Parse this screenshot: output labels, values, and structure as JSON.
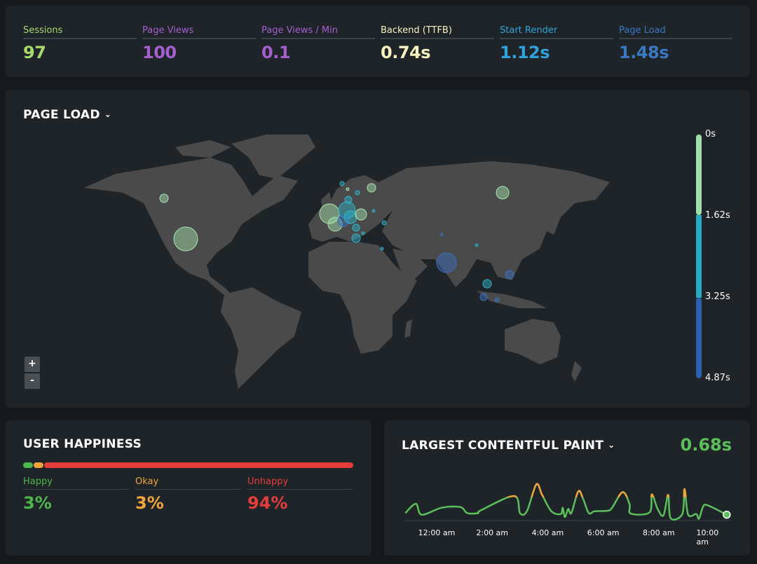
{
  "stats": [
    {
      "label": "Sessions",
      "value": "97",
      "color": "#a6d96a"
    },
    {
      "label": "Page Views",
      "value": "100",
      "color": "#a45fd0"
    },
    {
      "label": "Page Views / Min",
      "value": "0.1",
      "color": "#a45fd0"
    },
    {
      "label": "Backend (TTFB)",
      "value": "0.74s",
      "color": "#f7f3c0"
    },
    {
      "label": "Start Render",
      "value": "1.12s",
      "color": "#2ea3dc"
    },
    {
      "label": "Page Load",
      "value": "1.48s",
      "color": "#3a78c4"
    }
  ],
  "map": {
    "title": "PAGE LOAD",
    "legend": [
      "0s",
      "1.62s",
      "3.25s",
      "4.87s"
    ],
    "legend_colors": [
      "#9ddfa8",
      "#28a9c4",
      "#2b5fb0"
    ],
    "zoom_in": "+",
    "zoom_out": "-"
  },
  "happiness": {
    "title": "USER HAPPINESS",
    "segments": [
      {
        "label": "Happy",
        "value": "3%",
        "pct": 3,
        "color": "#4cb84c"
      },
      {
        "label": "Okay",
        "value": "3%",
        "pct": 3,
        "color": "#f2a33a"
      },
      {
        "label": "Unhappy",
        "value": "94%",
        "pct": 94,
        "color": "#e53c3c"
      }
    ]
  },
  "lcp": {
    "title": "LARGEST CONTENTFUL PAINT",
    "value": "0.68s",
    "color": "#5bbf5b",
    "warn_color": "#f2a33a",
    "ticks": [
      "12:00 am",
      "2:00 am",
      "4:00 am",
      "6:00 am",
      "8:00 am",
      "10:00 am"
    ]
  },
  "chart_data": {
    "type": "line",
    "xlabel": "",
    "ylabel": "",
    "x_ticks": [
      "12:00 am",
      "2:00 am",
      "4:00 am",
      "6:00 am",
      "8:00 am",
      "10:00 am"
    ],
    "x_hours": [
      -1.13,
      -0.75,
      -0.54,
      0.18,
      0.85,
      1.1,
      1.48,
      1.61,
      2.79,
      3.0,
      3.25,
      3.59,
      3.8,
      4.13,
      4.47,
      4.54,
      4.62,
      4.74,
      4.85,
      5.1,
      5.27,
      5.48,
      5.69,
      6.15,
      6.32,
      6.7,
      6.95,
      6.99,
      7.67,
      7.75,
      7.96,
      8.17,
      8.34,
      8.43,
      8.85,
      8.93,
      9.06,
      9.35,
      9.45,
      9.6,
      9.77,
      10.45
    ],
    "values": [
      0.32,
      0.72,
      0.25,
      0.55,
      0.58,
      0.32,
      0.32,
      0.45,
      1.05,
      0.32,
      0.4,
      1.55,
      1.1,
      0.4,
      0.28,
      0.55,
      0.15,
      0.5,
      0.32,
      1.25,
      0.95,
      0.32,
      0.4,
      0.42,
      0.55,
      1.22,
      0.7,
      0.3,
      0.35,
      1.12,
      0.5,
      0.22,
      1.1,
      0.1,
      0.28,
      1.35,
      0.25,
      0.28,
      0.08,
      0.6,
      0.65,
      0.25
    ]
  }
}
